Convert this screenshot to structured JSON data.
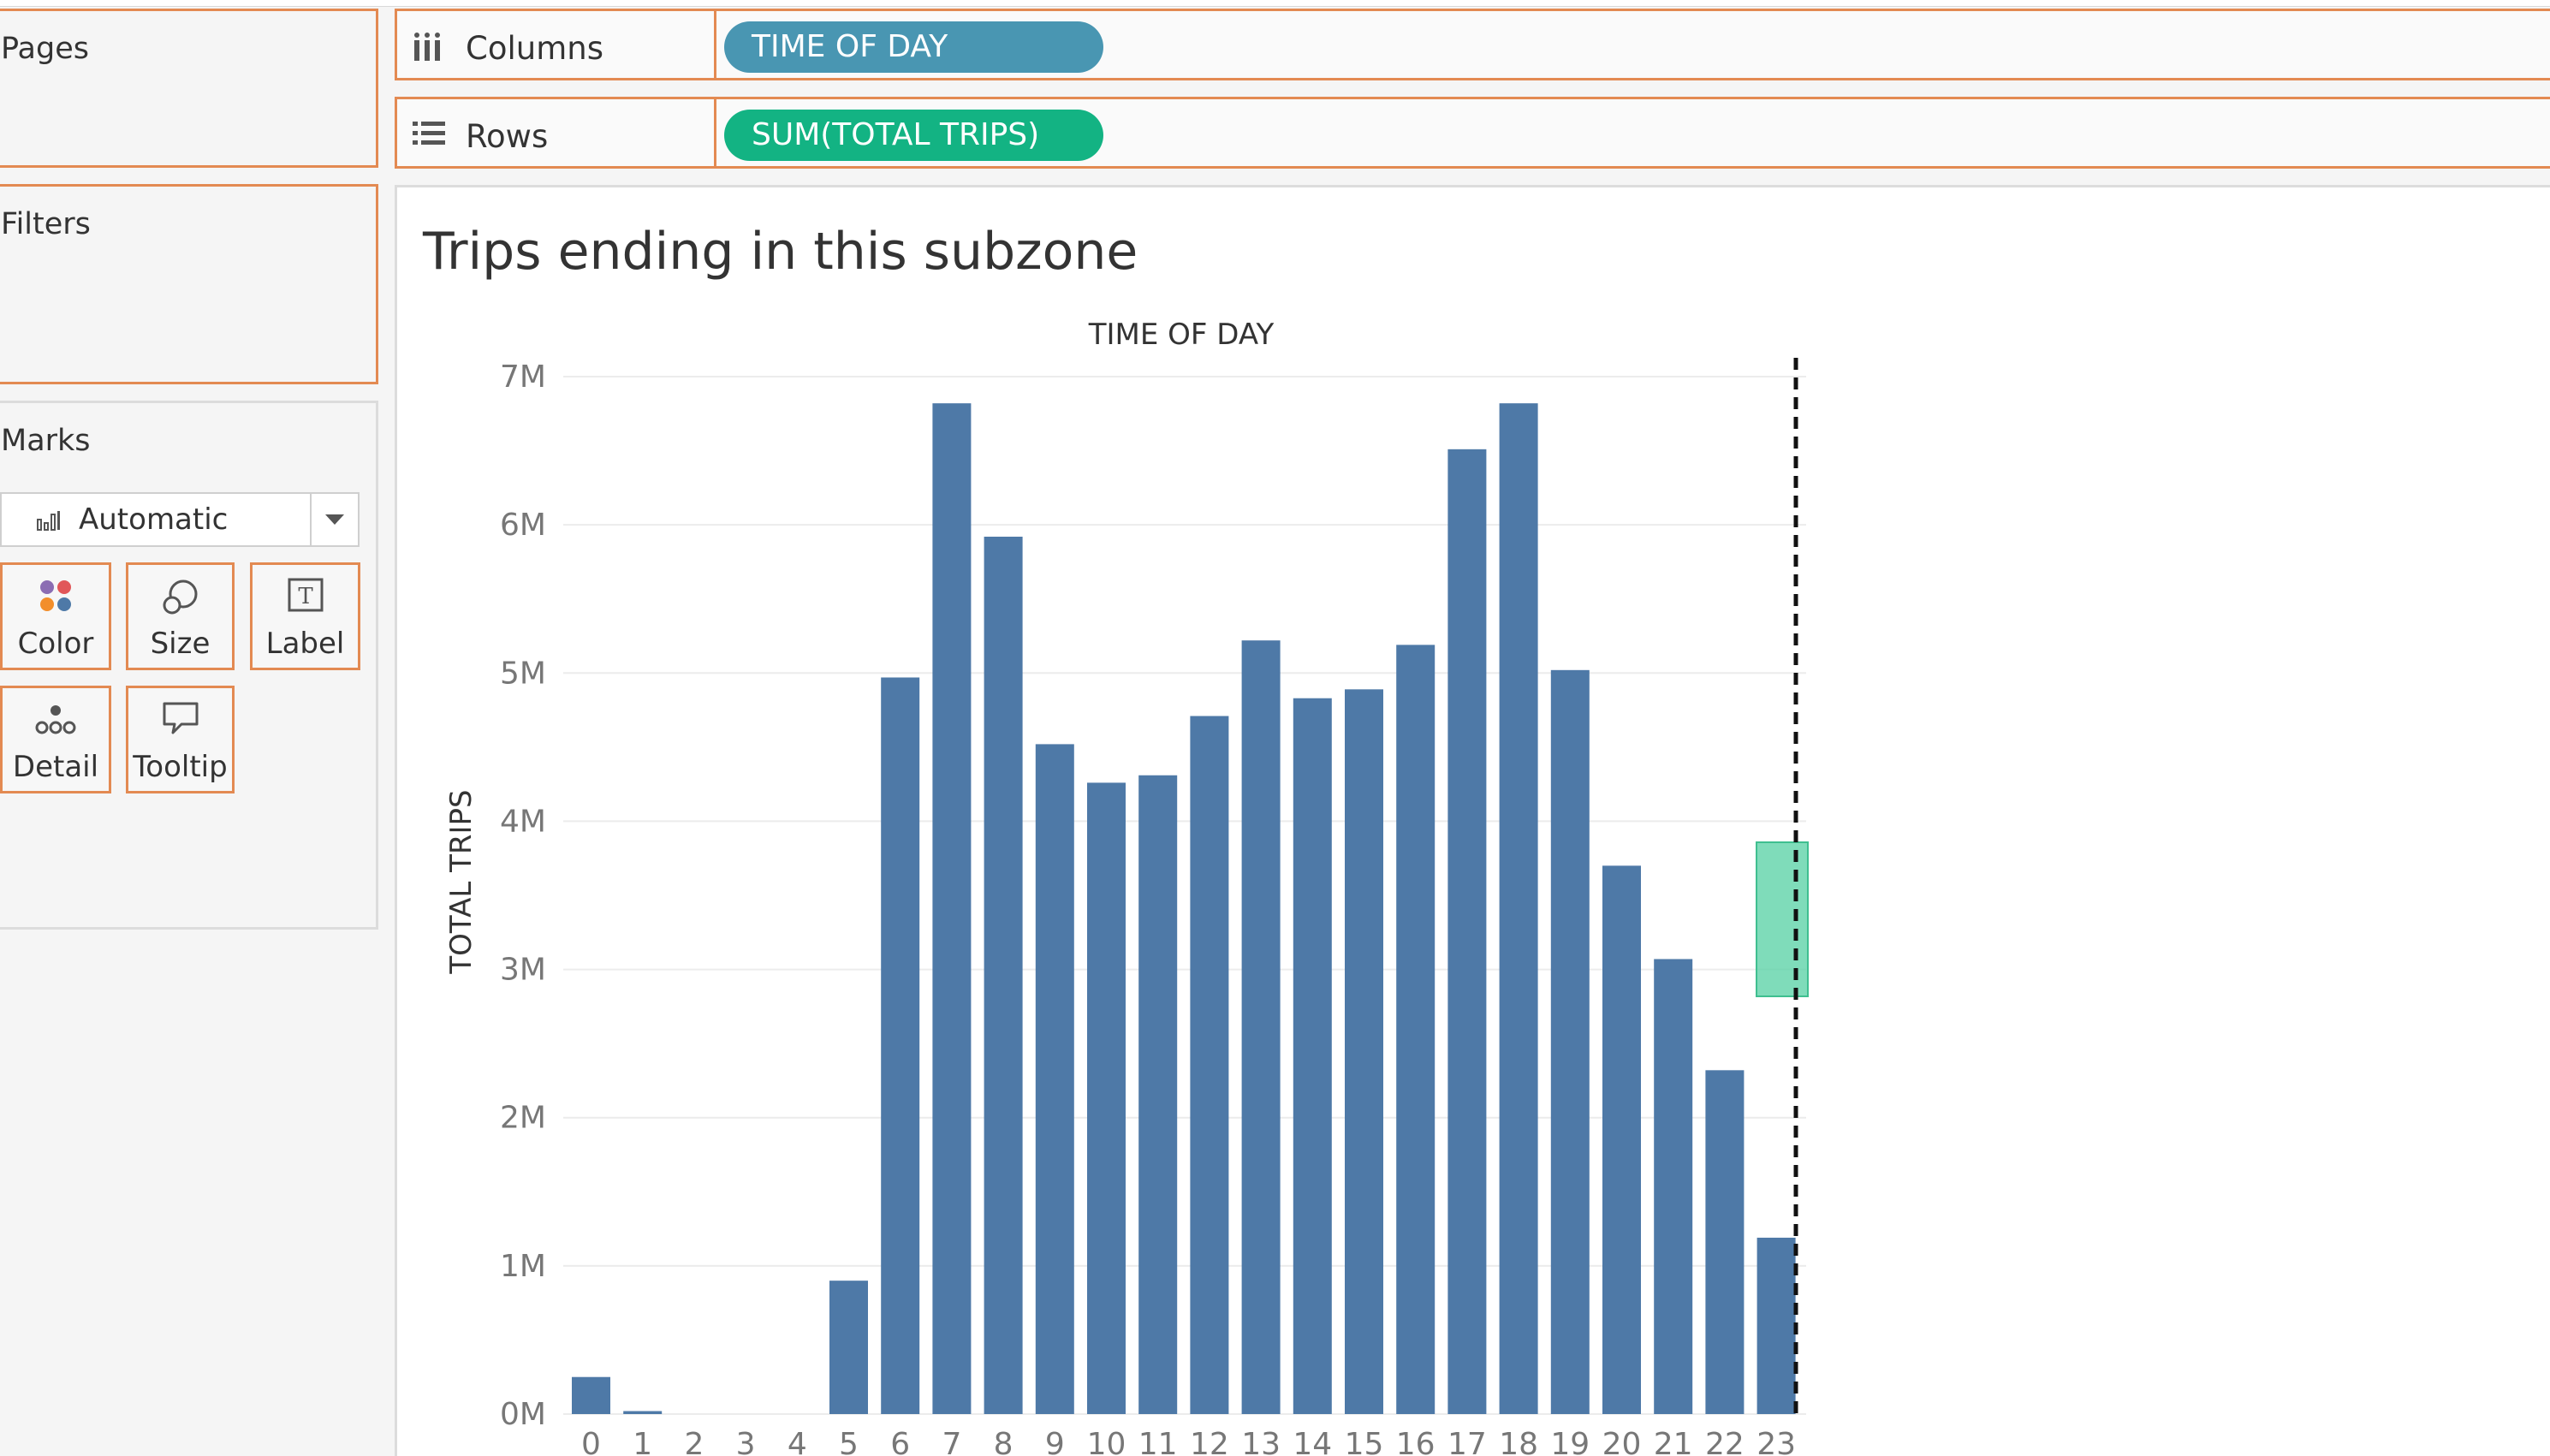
{
  "left_panel": {
    "pages_title": "Pages",
    "filters_title": "Filters",
    "marks_title": "Marks",
    "mark_type": "Automatic",
    "mark_buttons": [
      {
        "label": "Color",
        "icon": "color-dots-icon"
      },
      {
        "label": "Size",
        "icon": "size-circles-icon"
      },
      {
        "label": "Label",
        "icon": "text-label-icon"
      },
      {
        "label": "Detail",
        "icon": "detail-dots-icon"
      },
      {
        "label": "Tooltip",
        "icon": "tooltip-bubble-icon"
      }
    ]
  },
  "shelves": {
    "columns": {
      "label": "Columns",
      "pill": "TIME OF DAY",
      "pill_color": "#4996b2"
    },
    "rows": {
      "label": "Rows",
      "pill": "SUM(TOTAL TRIPS)",
      "pill_color": "#13b383"
    }
  },
  "viz": {
    "title": "Trips ending in this subzone"
  },
  "chart_data": {
    "type": "bar",
    "title": "TIME OF DAY",
    "xlabel": "TIME OF DAY",
    "ylabel": "TOTAL TRIPS",
    "categories": [
      "0",
      "1",
      "2",
      "3",
      "4",
      "5",
      "6",
      "7",
      "8",
      "9",
      "10",
      "11",
      "12",
      "13",
      "14",
      "15",
      "16",
      "17",
      "18",
      "19",
      "20",
      "21",
      "22",
      "23"
    ],
    "values": [
      0.25,
      0.02,
      0,
      0,
      0,
      0.9,
      4.97,
      6.82,
      5.92,
      4.52,
      4.26,
      4.31,
      4.71,
      5.22,
      4.83,
      4.89,
      5.19,
      6.51,
      6.82,
      5.02,
      3.7,
      3.07,
      2.32,
      1.19
    ],
    "y_unit": "M",
    "yticks": [
      "0M",
      "1M",
      "2M",
      "3M",
      "4M",
      "5M",
      "6M",
      "7M"
    ],
    "ylim": [
      0,
      7
    ],
    "grid": true,
    "bar_color": "#4e79a7",
    "drop_target_color": "#5fd3a9"
  }
}
